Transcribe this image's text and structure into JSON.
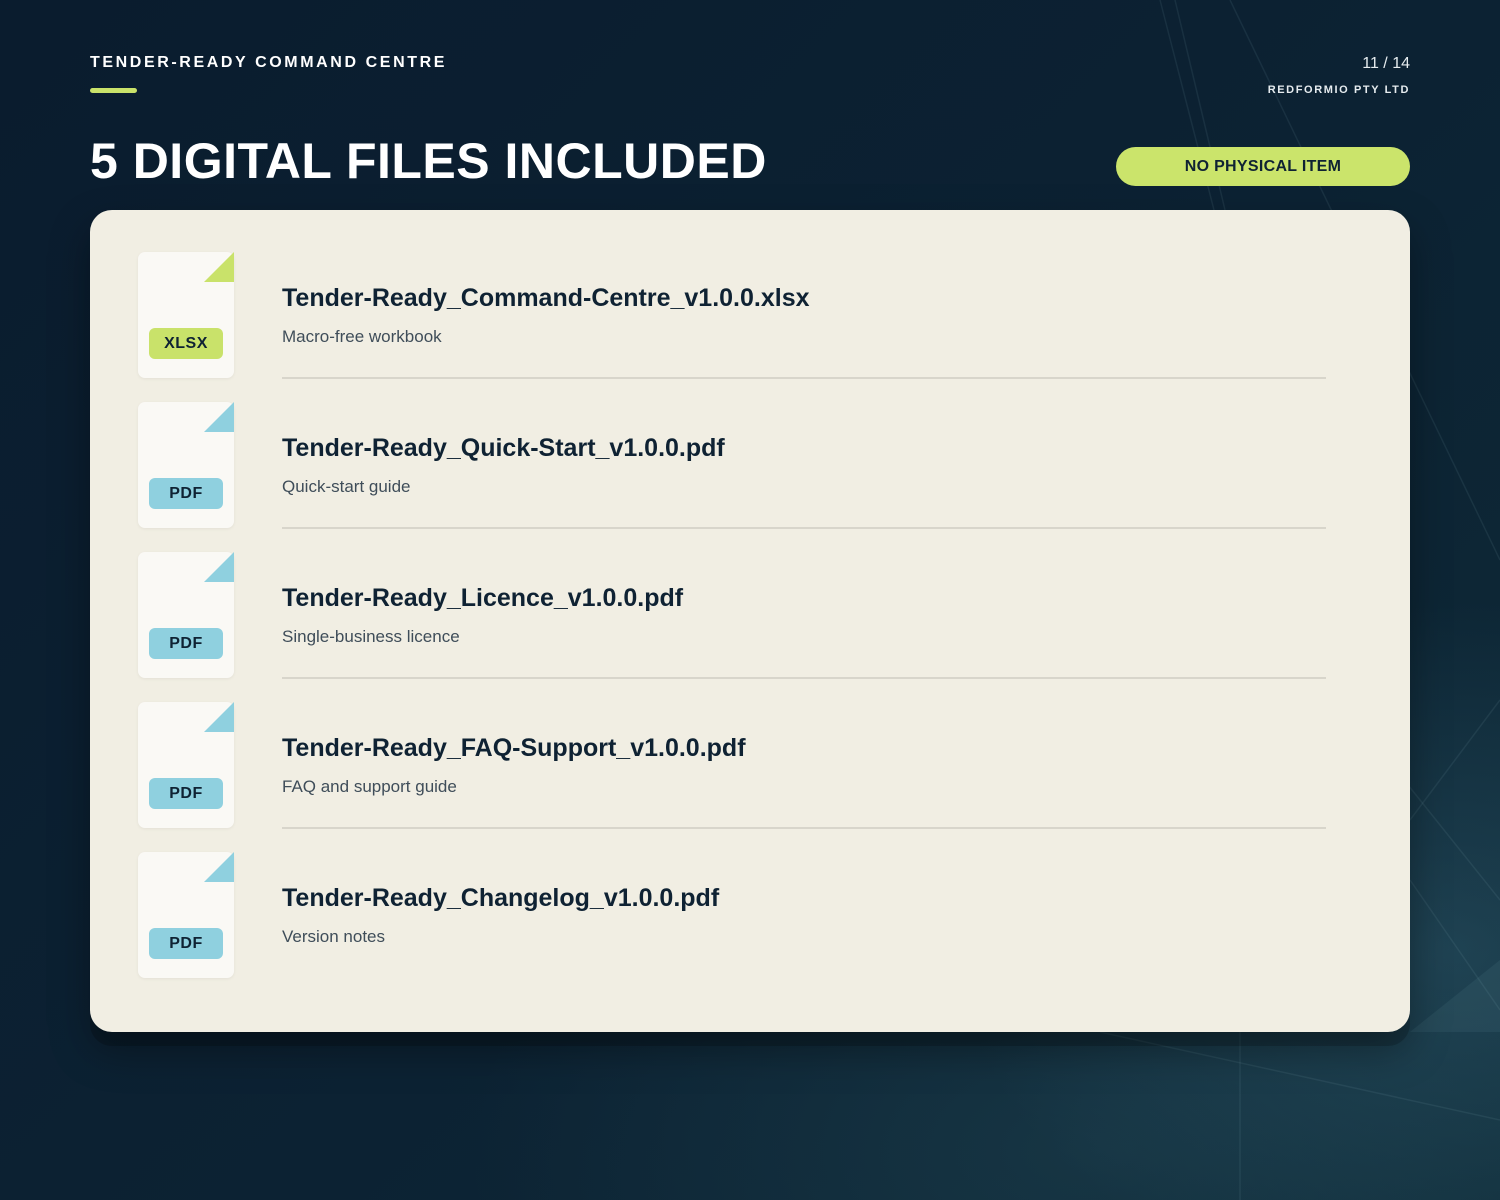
{
  "header": {
    "brand": "TENDER-READY COMMAND CENTRE",
    "page_counter": "11 / 14",
    "company": "REDFORMIO PTY LTD"
  },
  "title": "5 DIGITAL FILES INCLUDED",
  "badge": "NO PHYSICAL ITEM",
  "colors": {
    "accent_green": "#c9e26a",
    "pdf_blue": "#8fd0df",
    "card_bg": "#f1eee3",
    "page_bg": "#0b1f30",
    "text_dark": "#0f2233"
  },
  "files": [
    {
      "type": "XLSX",
      "name": "Tender-Ready_Command-Centre_v1.0.0.xlsx",
      "description": "Macro-free workbook",
      "icon": "spreadsheet-file-icon"
    },
    {
      "type": "PDF",
      "name": "Tender-Ready_Quick-Start_v1.0.0.pdf",
      "description": "Quick-start guide",
      "icon": "pdf-file-icon"
    },
    {
      "type": "PDF",
      "name": "Tender-Ready_Licence_v1.0.0.pdf",
      "description": "Single-business licence",
      "icon": "pdf-file-icon"
    },
    {
      "type": "PDF",
      "name": "Tender-Ready_FAQ-Support_v1.0.0.pdf",
      "description": "FAQ and support guide",
      "icon": "pdf-file-icon"
    },
    {
      "type": "PDF",
      "name": "Tender-Ready_Changelog_v1.0.0.pdf",
      "description": "Version notes",
      "icon": "pdf-file-icon"
    }
  ]
}
